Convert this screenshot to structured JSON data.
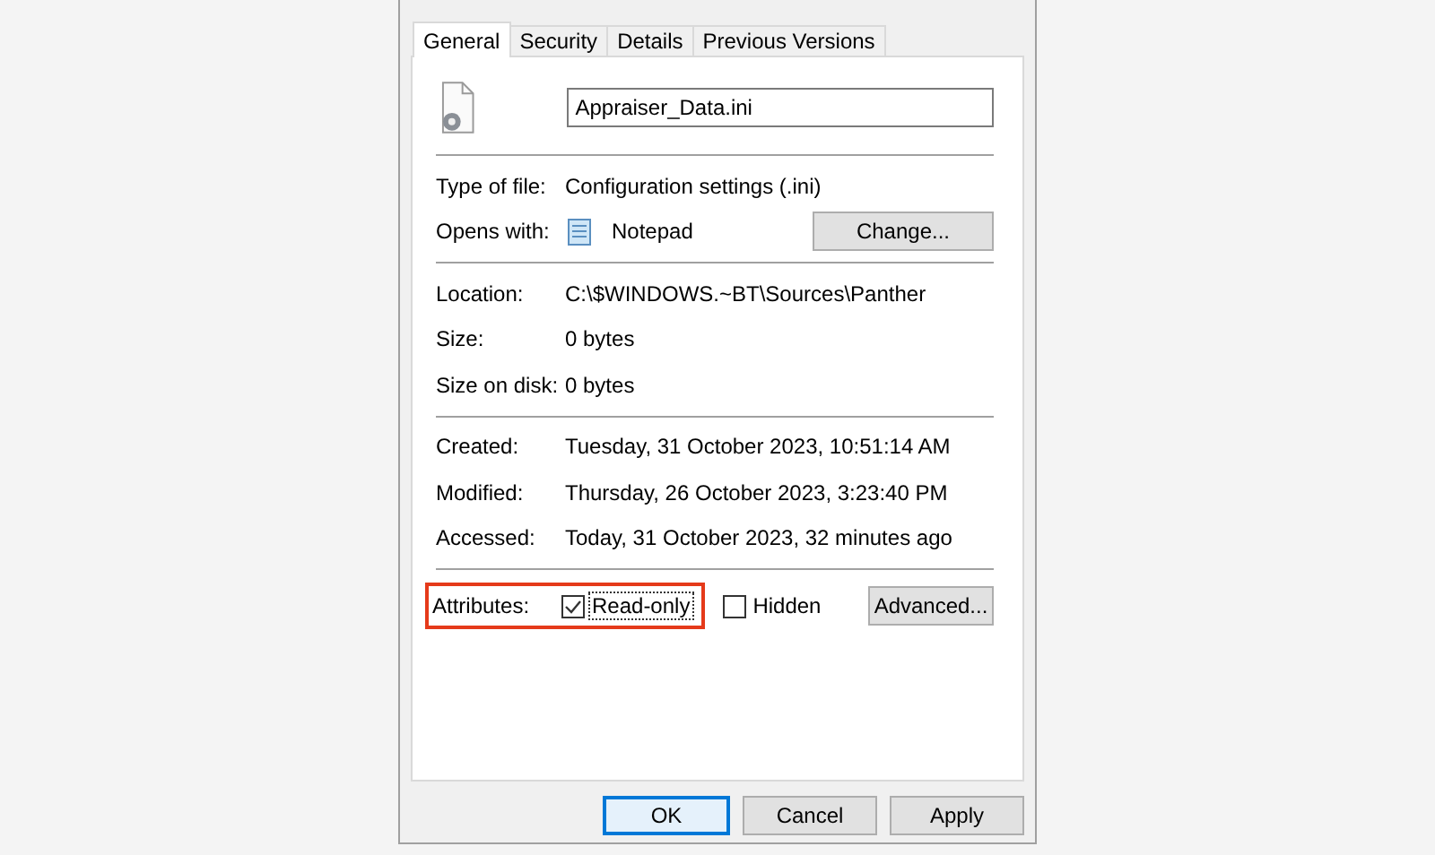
{
  "tabs": [
    {
      "label": "General",
      "selected": true
    },
    {
      "label": "Security",
      "selected": false
    },
    {
      "label": "Details",
      "selected": false
    },
    {
      "label": "Previous Versions",
      "selected": false
    }
  ],
  "file_name": "Appraiser_Data.ini",
  "type_section": [
    {
      "label": "Type of file:",
      "value": "Configuration settings (.ini)"
    },
    {
      "label": "Opens with:",
      "value": "Notepad",
      "button": "Change..."
    }
  ],
  "location_section": [
    {
      "label": "Location:",
      "value": "C:\\$WINDOWS.~BT\\Sources\\Panther"
    },
    {
      "label": "Size:",
      "value": "0 bytes"
    },
    {
      "label": "Size on disk:",
      "value": "0 bytes"
    }
  ],
  "dates_section": [
    {
      "label": "Created:",
      "value": "Tuesday, 31 October 2023, 10:51:14 AM"
    },
    {
      "label": "Modified:",
      "value": "Thursday, 26 October 2023, 3:23:40 PM"
    },
    {
      "label": "Accessed:",
      "value": "Today, 31 October 2023, 32 minutes ago"
    }
  ],
  "attributes": {
    "label": "Attributes:",
    "highlighted": true,
    "checkboxes": [
      {
        "label": "Read-only",
        "checked": true,
        "focused": true
      },
      {
        "label": "Hidden",
        "checked": false,
        "focused": false
      }
    ],
    "button": "Advanced..."
  },
  "buttons": [
    {
      "label": "OK",
      "default": true
    },
    {
      "label": "Cancel",
      "default": false
    },
    {
      "label": "Apply",
      "default": false
    }
  ]
}
